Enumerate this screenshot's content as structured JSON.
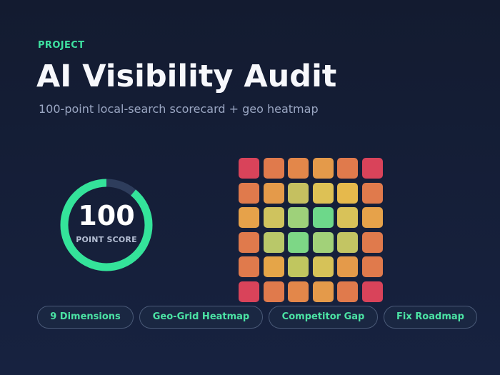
{
  "header": {
    "kicker": "PROJECT",
    "title": "AI Visibility Audit",
    "subtitle": "100-point local-search scorecard + geo heatmap"
  },
  "score": {
    "value": "100",
    "label": "POINT SCORE",
    "ring_fill_fraction": 0.89,
    "ring_color": "#34e39a",
    "track_color": "#2e3d5c"
  },
  "heatmap": {
    "rows": 6,
    "cols": 6,
    "colors": [
      [
        "#d9435a",
        "#e07a4c",
        "#e3874a",
        "#e49a4a",
        "#e07a4c",
        "#d9435a"
      ],
      [
        "#e07a4c",
        "#e49a4a",
        "#c5c060",
        "#ddc155",
        "#e6b94c",
        "#e07a4c"
      ],
      [
        "#e6a24a",
        "#cfc35e",
        "#9ed17a",
        "#6dd88a",
        "#d8c259",
        "#e6a24a"
      ],
      [
        "#e07a4c",
        "#b9c869",
        "#7dd786",
        "#a2d179",
        "#c3c563",
        "#e07a4c"
      ],
      [
        "#e07a4c",
        "#e5a548",
        "#c0c65f",
        "#d6c258",
        "#e49a4a",
        "#e07a4c"
      ],
      [
        "#d9435a",
        "#e07a4c",
        "#e3874a",
        "#e49a4a",
        "#e07a4c",
        "#d9435a"
      ]
    ]
  },
  "tags": [
    {
      "label": "9 Dimensions"
    },
    {
      "label": "Geo-Grid Heatmap"
    },
    {
      "label": "Competitor Gap"
    },
    {
      "label": "Fix Roadmap"
    }
  ],
  "colors": {
    "accent": "#3ee0a0",
    "background": "#131b30"
  }
}
